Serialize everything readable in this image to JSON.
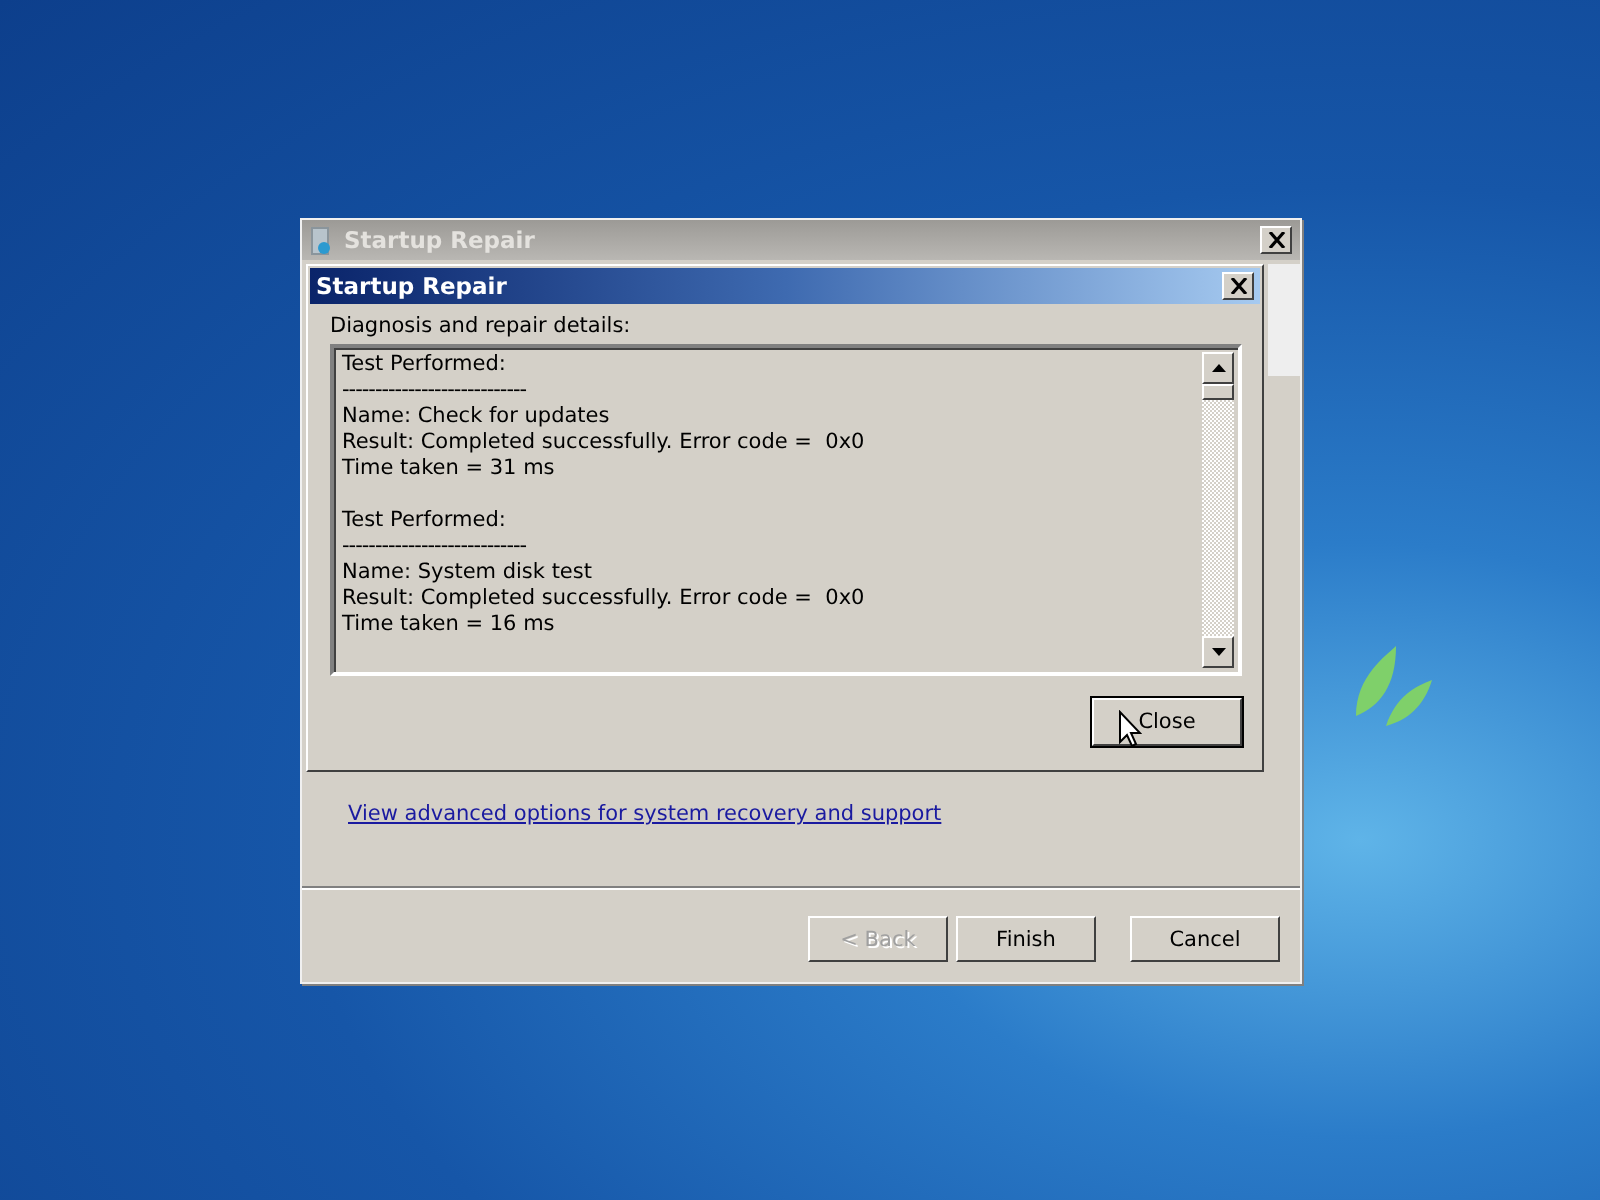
{
  "window": {
    "title": "Startup Repair",
    "link": "View advanced options for system recovery and support",
    "buttons": [
      {
        "label": "< Back",
        "disabled": true
      },
      {
        "label": "Finish",
        "disabled": false
      },
      {
        "label": "Cancel",
        "disabled": false
      }
    ]
  },
  "dialog": {
    "title": "Startup Repair",
    "label": "Diagnosis and repair details:",
    "log": [
      {
        "heading": "Test Performed:",
        "separator": "----------------------------",
        "lines": [
          "Name: Check for updates",
          "Result: Completed successfully. Error code =  0x0",
          "Time taken = 31 ms"
        ]
      },
      {
        "heading": "Test Performed:",
        "separator": "----------------------------",
        "lines": [
          "Name: System disk test",
          "Result: Completed successfully. Error code =  0x0",
          "Time taken = 16 ms"
        ]
      }
    ],
    "close_button": "Close"
  }
}
